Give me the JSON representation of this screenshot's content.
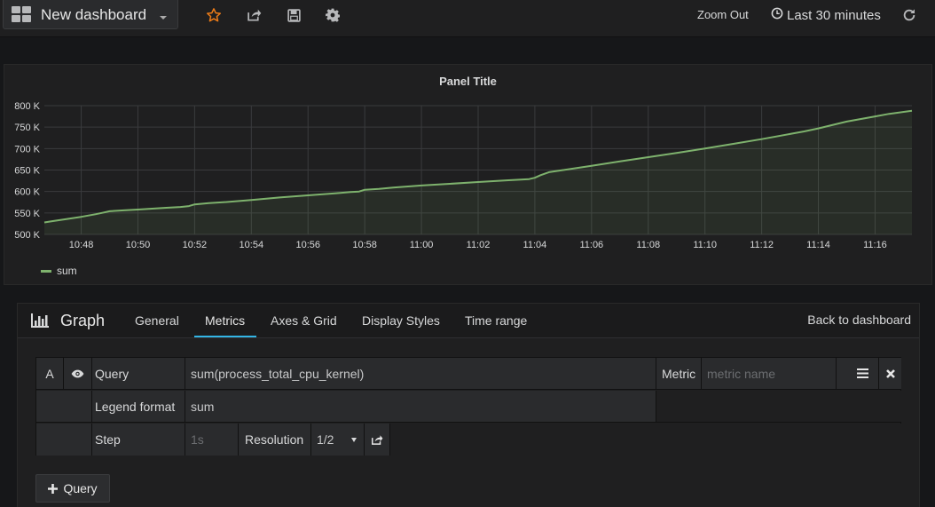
{
  "navbar": {
    "dashboard_title": "New dashboard",
    "zoom_out_label": "Zoom Out",
    "time_range_label": "Last 30 minutes",
    "star_color": "#eb7b18",
    "icons": [
      "star-icon",
      "share-icon",
      "save-icon",
      "gear-icon",
      "clock-icon",
      "refresh-icon"
    ]
  },
  "panel": {
    "title": "Panel Title"
  },
  "chart_data": {
    "type": "area",
    "title": "Panel Title",
    "xlabel": "",
    "ylabel": "",
    "y_tick_labels": [
      "500 K",
      "550 K",
      "600 K",
      "650 K",
      "700 K",
      "750 K",
      "800 K"
    ],
    "y_ticks": [
      500000,
      550000,
      600000,
      650000,
      700000,
      750000,
      800000
    ],
    "ylim": [
      500000,
      800000
    ],
    "x_tick_labels": [
      "10:48",
      "10:50",
      "10:52",
      "10:54",
      "10:56",
      "10:58",
      "11:00",
      "11:02",
      "11:04",
      "11:06",
      "11:08",
      "11:10",
      "11:12",
      "11:14",
      "11:16"
    ],
    "x_ticks_min": [
      648,
      650,
      652,
      654,
      656,
      658,
      660,
      662,
      664,
      666,
      668,
      670,
      672,
      674,
      676
    ],
    "xlim_min": [
      646.7,
      677.3
    ],
    "grid": true,
    "legend_position": "bottom-left",
    "line_color": "#7eb26d",
    "series": [
      {
        "name": "sum",
        "x_min": [
          646.7,
          647.0,
          647.5,
          648.0,
          648.5,
          648.8,
          649.0,
          649.5,
          650.0,
          650.5,
          651.0,
          651.5,
          651.8,
          652.0,
          652.5,
          653.0,
          654.0,
          655.0,
          656.0,
          657.0,
          657.5,
          657.8,
          658.0,
          658.5,
          659.0,
          660.0,
          661.0,
          662.0,
          663.0,
          663.8,
          664.0,
          664.2,
          664.5,
          665.0,
          666.0,
          667.0,
          668.0,
          669.0,
          670.0,
          671.0,
          672.0,
          673.0,
          673.5,
          674.0,
          675.0,
          676.0,
          676.5,
          677.3
        ],
        "values": [
          528000,
          531000,
          536000,
          541000,
          547000,
          551000,
          554000,
          556000,
          558000,
          560000,
          562000,
          564000,
          566000,
          570000,
          573000,
          575000,
          580000,
          586000,
          591000,
          596000,
          599000,
          600000,
          604000,
          606000,
          609000,
          614000,
          618000,
          622000,
          626000,
          629000,
          632000,
          638000,
          645000,
          650000,
          660000,
          670000,
          680000,
          690000,
          700000,
          711000,
          722000,
          734000,
          740000,
          747000,
          763000,
          775000,
          781000,
          788000
        ]
      }
    ]
  },
  "editor": {
    "panel_type": "Graph",
    "tabs": [
      "General",
      "Metrics",
      "Axes & Grid",
      "Display Styles",
      "Time range"
    ],
    "active_tab": "Metrics",
    "back_label": "Back to dashboard",
    "query": {
      "ref_id": "A",
      "query_label": "Query",
      "query_value": "sum(process_total_cpu_kernel)",
      "metric_label": "Metric",
      "metric_placeholder": "metric name",
      "legend_label": "Legend format",
      "legend_value": "sum",
      "step_label": "Step",
      "step_placeholder": "1s",
      "resolution_label": "Resolution",
      "resolution_value": "1/2"
    },
    "add_query_label": "Query"
  }
}
